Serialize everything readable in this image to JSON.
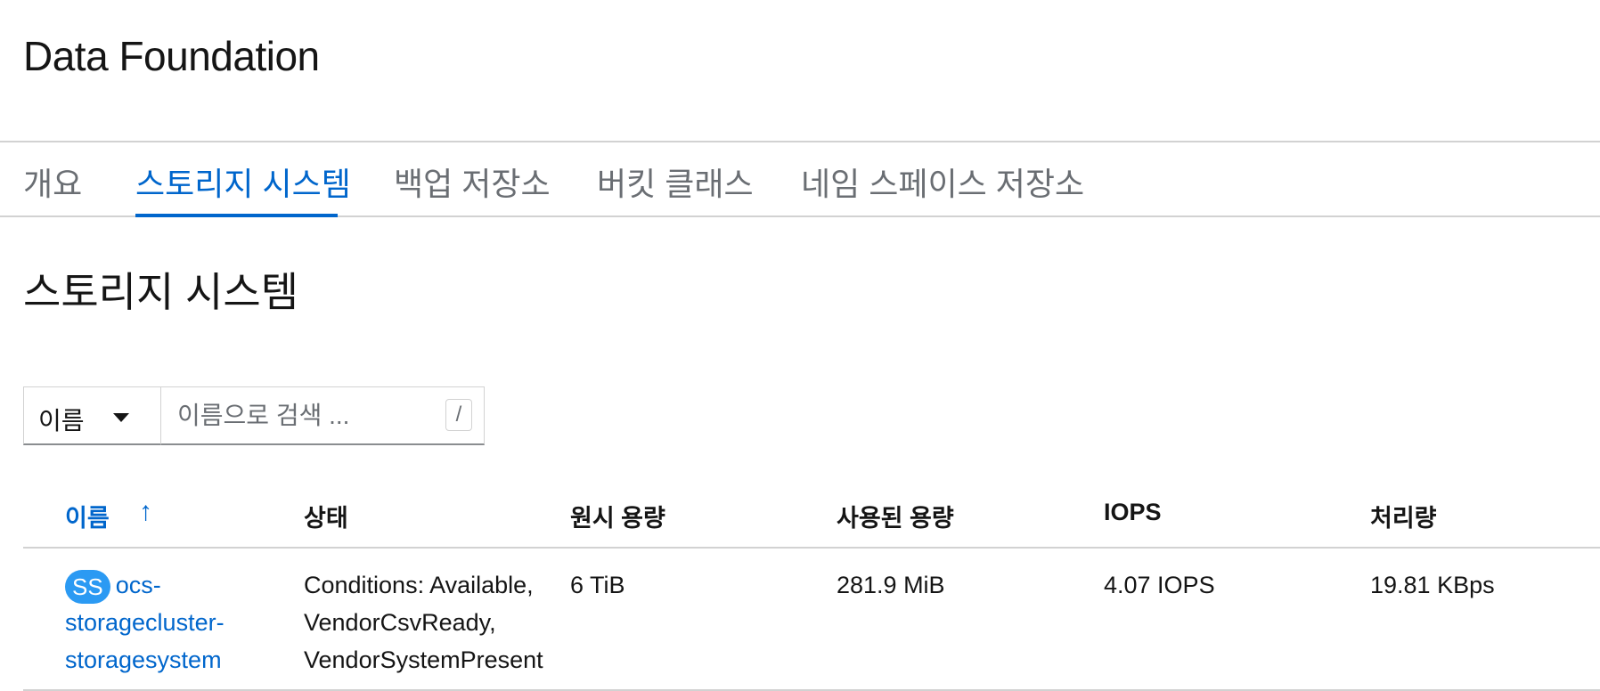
{
  "header": {
    "title": "Data Foundation"
  },
  "tabs": [
    {
      "label": "개요",
      "active": false
    },
    {
      "label": "스토리지 시스템",
      "active": true
    },
    {
      "label": "백업 저장소",
      "active": false
    },
    {
      "label": "버킷 클래스",
      "active": false
    },
    {
      "label": "네임 스페이스 저장소",
      "active": false
    }
  ],
  "section": {
    "title": "스토리지 시스템"
  },
  "filter": {
    "selected": "이름",
    "search_placeholder": "이름으로 검색 ...",
    "shortcut": "/"
  },
  "table": {
    "columns": [
      "이름",
      "상태",
      "원시 용량",
      "사용된 용량",
      "IOPS",
      "처리량"
    ],
    "sort_icon": "↑",
    "rows": [
      {
        "badge": "SS",
        "name": "ocs-storagecluster-storagesystem",
        "name_lines": [
          "ocs-",
          "storagecluster-",
          "storagesystem"
        ],
        "status_lines": [
          "Conditions: Available,",
          "VendorCsvReady,",
          "VendorSystemPresent"
        ],
        "raw_capacity": "6 TiB",
        "used_capacity": "281.9 MiB",
        "iops": "4.07 IOPS",
        "throughput": "19.81 KBps"
      }
    ]
  },
  "colors": {
    "accent": "#0066cc",
    "badge": "#2b9af3",
    "border": "#d2d2d2",
    "muted": "#6a6e73"
  }
}
